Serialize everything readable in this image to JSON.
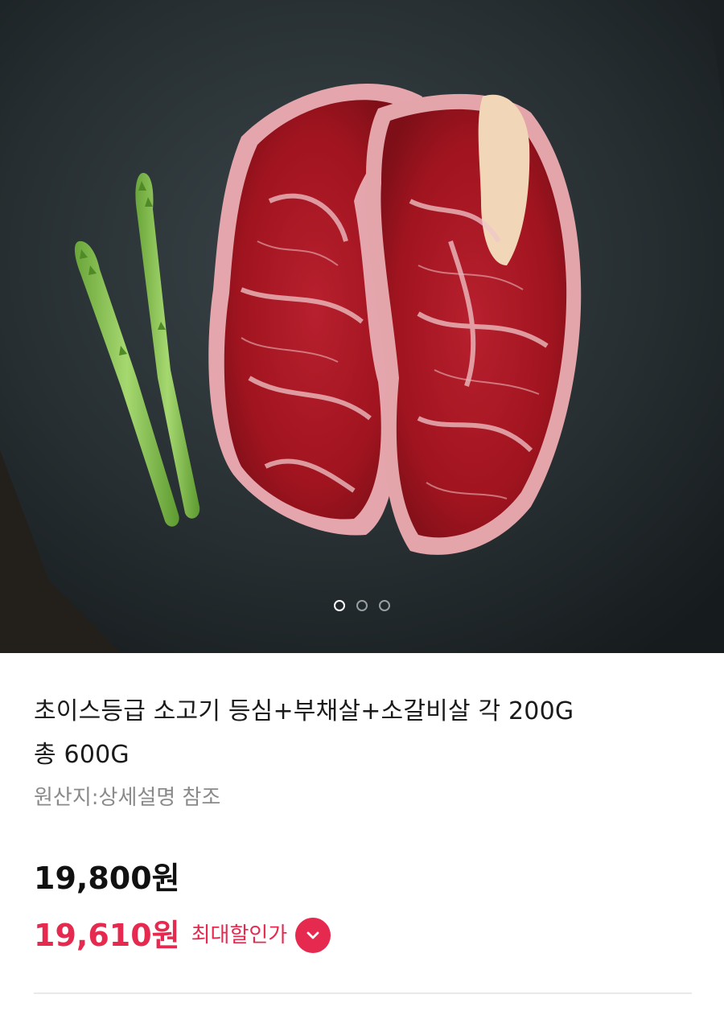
{
  "carousel": {
    "image_alt": "beef steaks with asparagus",
    "slide_count": 3,
    "active_index": 0
  },
  "product": {
    "title_line1": "초이스등급 소고기 등심+부채살+소갈비살 각 200G",
    "title_line2": "총 600G",
    "origin": "원산지:상세설명 참조",
    "price": "19,800원",
    "sale_price": "19,610원",
    "sale_label": "최대할인가"
  },
  "colors": {
    "accent": "#e5294f",
    "text": "#111111",
    "muted": "#8a8a8a"
  },
  "icons": {
    "discount_toggle": "chevron-down-icon"
  }
}
